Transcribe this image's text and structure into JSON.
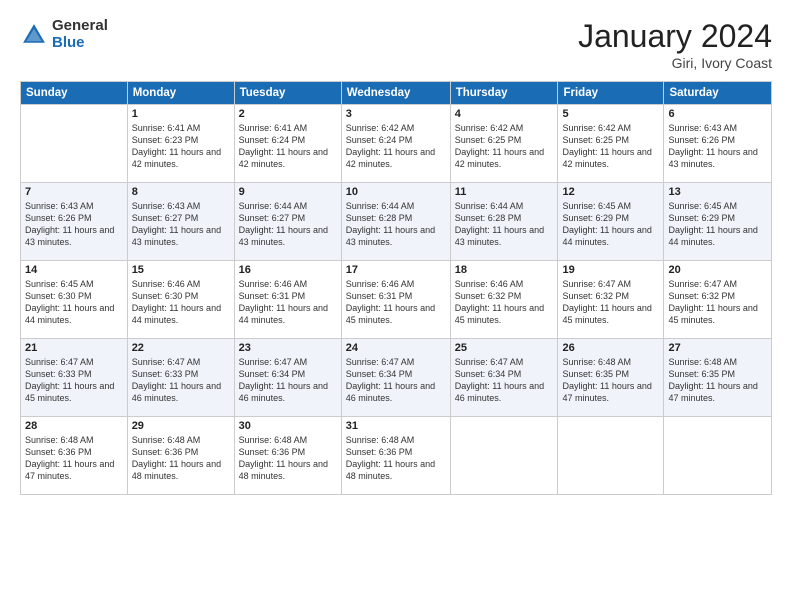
{
  "logo": {
    "general": "General",
    "blue": "Blue"
  },
  "title": "January 2024",
  "location": "Giri, Ivory Coast",
  "days_header": [
    "Sunday",
    "Monday",
    "Tuesday",
    "Wednesday",
    "Thursday",
    "Friday",
    "Saturday"
  ],
  "weeks": [
    [
      {
        "day": "",
        "sunrise": "",
        "sunset": "",
        "daylight": ""
      },
      {
        "day": "1",
        "sunrise": "Sunrise: 6:41 AM",
        "sunset": "Sunset: 6:23 PM",
        "daylight": "Daylight: 11 hours and 42 minutes."
      },
      {
        "day": "2",
        "sunrise": "Sunrise: 6:41 AM",
        "sunset": "Sunset: 6:24 PM",
        "daylight": "Daylight: 11 hours and 42 minutes."
      },
      {
        "day": "3",
        "sunrise": "Sunrise: 6:42 AM",
        "sunset": "Sunset: 6:24 PM",
        "daylight": "Daylight: 11 hours and 42 minutes."
      },
      {
        "day": "4",
        "sunrise": "Sunrise: 6:42 AM",
        "sunset": "Sunset: 6:25 PM",
        "daylight": "Daylight: 11 hours and 42 minutes."
      },
      {
        "day": "5",
        "sunrise": "Sunrise: 6:42 AM",
        "sunset": "Sunset: 6:25 PM",
        "daylight": "Daylight: 11 hours and 42 minutes."
      },
      {
        "day": "6",
        "sunrise": "Sunrise: 6:43 AM",
        "sunset": "Sunset: 6:26 PM",
        "daylight": "Daylight: 11 hours and 43 minutes."
      }
    ],
    [
      {
        "day": "7",
        "sunrise": "Sunrise: 6:43 AM",
        "sunset": "Sunset: 6:26 PM",
        "daylight": "Daylight: 11 hours and 43 minutes."
      },
      {
        "day": "8",
        "sunrise": "Sunrise: 6:43 AM",
        "sunset": "Sunset: 6:27 PM",
        "daylight": "Daylight: 11 hours and 43 minutes."
      },
      {
        "day": "9",
        "sunrise": "Sunrise: 6:44 AM",
        "sunset": "Sunset: 6:27 PM",
        "daylight": "Daylight: 11 hours and 43 minutes."
      },
      {
        "day": "10",
        "sunrise": "Sunrise: 6:44 AM",
        "sunset": "Sunset: 6:28 PM",
        "daylight": "Daylight: 11 hours and 43 minutes."
      },
      {
        "day": "11",
        "sunrise": "Sunrise: 6:44 AM",
        "sunset": "Sunset: 6:28 PM",
        "daylight": "Daylight: 11 hours and 43 minutes."
      },
      {
        "day": "12",
        "sunrise": "Sunrise: 6:45 AM",
        "sunset": "Sunset: 6:29 PM",
        "daylight": "Daylight: 11 hours and 44 minutes."
      },
      {
        "day": "13",
        "sunrise": "Sunrise: 6:45 AM",
        "sunset": "Sunset: 6:29 PM",
        "daylight": "Daylight: 11 hours and 44 minutes."
      }
    ],
    [
      {
        "day": "14",
        "sunrise": "Sunrise: 6:45 AM",
        "sunset": "Sunset: 6:30 PM",
        "daylight": "Daylight: 11 hours and 44 minutes."
      },
      {
        "day": "15",
        "sunrise": "Sunrise: 6:46 AM",
        "sunset": "Sunset: 6:30 PM",
        "daylight": "Daylight: 11 hours and 44 minutes."
      },
      {
        "day": "16",
        "sunrise": "Sunrise: 6:46 AM",
        "sunset": "Sunset: 6:31 PM",
        "daylight": "Daylight: 11 hours and 44 minutes."
      },
      {
        "day": "17",
        "sunrise": "Sunrise: 6:46 AM",
        "sunset": "Sunset: 6:31 PM",
        "daylight": "Daylight: 11 hours and 45 minutes."
      },
      {
        "day": "18",
        "sunrise": "Sunrise: 6:46 AM",
        "sunset": "Sunset: 6:32 PM",
        "daylight": "Daylight: 11 hours and 45 minutes."
      },
      {
        "day": "19",
        "sunrise": "Sunrise: 6:47 AM",
        "sunset": "Sunset: 6:32 PM",
        "daylight": "Daylight: 11 hours and 45 minutes."
      },
      {
        "day": "20",
        "sunrise": "Sunrise: 6:47 AM",
        "sunset": "Sunset: 6:32 PM",
        "daylight": "Daylight: 11 hours and 45 minutes."
      }
    ],
    [
      {
        "day": "21",
        "sunrise": "Sunrise: 6:47 AM",
        "sunset": "Sunset: 6:33 PM",
        "daylight": "Daylight: 11 hours and 45 minutes."
      },
      {
        "day": "22",
        "sunrise": "Sunrise: 6:47 AM",
        "sunset": "Sunset: 6:33 PM",
        "daylight": "Daylight: 11 hours and 46 minutes."
      },
      {
        "day": "23",
        "sunrise": "Sunrise: 6:47 AM",
        "sunset": "Sunset: 6:34 PM",
        "daylight": "Daylight: 11 hours and 46 minutes."
      },
      {
        "day": "24",
        "sunrise": "Sunrise: 6:47 AM",
        "sunset": "Sunset: 6:34 PM",
        "daylight": "Daylight: 11 hours and 46 minutes."
      },
      {
        "day": "25",
        "sunrise": "Sunrise: 6:47 AM",
        "sunset": "Sunset: 6:34 PM",
        "daylight": "Daylight: 11 hours and 46 minutes."
      },
      {
        "day": "26",
        "sunrise": "Sunrise: 6:48 AM",
        "sunset": "Sunset: 6:35 PM",
        "daylight": "Daylight: 11 hours and 47 minutes."
      },
      {
        "day": "27",
        "sunrise": "Sunrise: 6:48 AM",
        "sunset": "Sunset: 6:35 PM",
        "daylight": "Daylight: 11 hours and 47 minutes."
      }
    ],
    [
      {
        "day": "28",
        "sunrise": "Sunrise: 6:48 AM",
        "sunset": "Sunset: 6:36 PM",
        "daylight": "Daylight: 11 hours and 47 minutes."
      },
      {
        "day": "29",
        "sunrise": "Sunrise: 6:48 AM",
        "sunset": "Sunset: 6:36 PM",
        "daylight": "Daylight: 11 hours and 48 minutes."
      },
      {
        "day": "30",
        "sunrise": "Sunrise: 6:48 AM",
        "sunset": "Sunset: 6:36 PM",
        "daylight": "Daylight: 11 hours and 48 minutes."
      },
      {
        "day": "31",
        "sunrise": "Sunrise: 6:48 AM",
        "sunset": "Sunset: 6:36 PM",
        "daylight": "Daylight: 11 hours and 48 minutes."
      },
      {
        "day": "",
        "sunrise": "",
        "sunset": "",
        "daylight": ""
      },
      {
        "day": "",
        "sunrise": "",
        "sunset": "",
        "daylight": ""
      },
      {
        "day": "",
        "sunrise": "",
        "sunset": "",
        "daylight": ""
      }
    ]
  ]
}
